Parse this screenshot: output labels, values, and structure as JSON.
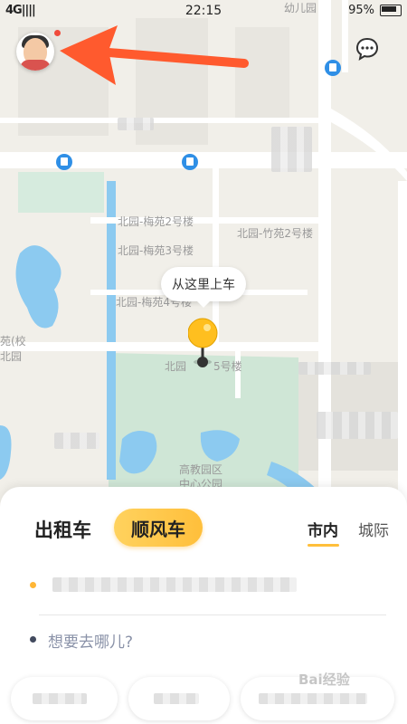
{
  "status_bar": {
    "left_text": "4G|||| ",
    "time": "22:15",
    "battery": "95%"
  },
  "map": {
    "labels": [
      {
        "text": "幼儿园"
      },
      {
        "text": "北园-梅苑2号楼"
      },
      {
        "text": "北园-竹苑2号楼"
      },
      {
        "text": "北园-梅苑3号楼"
      },
      {
        "text": "北园-梅苑4号楼"
      },
      {
        "text": "北园"
      },
      {
        "text": "5号楼"
      },
      {
        "text": "苑(校"
      },
      {
        "text": "北园"
      },
      {
        "text": "高教园区"
      },
      {
        "text": "中心公园"
      }
    ]
  },
  "pickup": {
    "bubble_text": "从这里上车"
  },
  "panel": {
    "tab_taxi": "出租车",
    "tab_ride": "顺风车",
    "seg_city": "市内",
    "seg_intercity": "城际",
    "destination_placeholder": "想要去哪儿?"
  },
  "watermark": "Bai经验",
  "colors": {
    "accent": "#ffbf3b",
    "road": "#ffffff",
    "water": "#8ccaf0",
    "park": "#cfe6d6"
  }
}
